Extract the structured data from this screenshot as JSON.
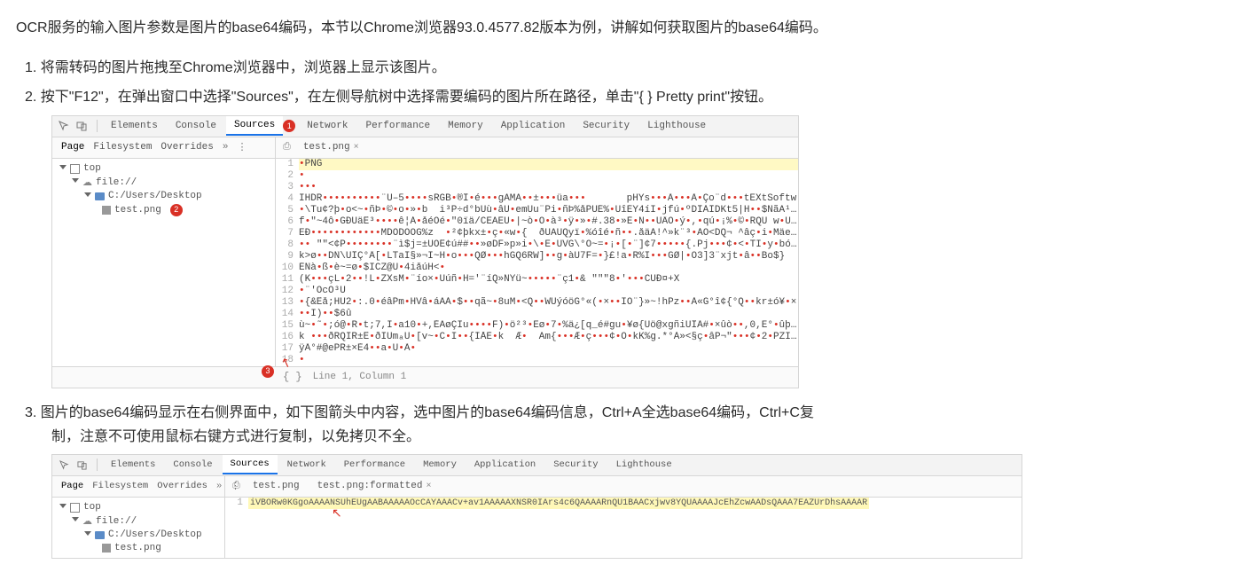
{
  "intro": "OCR服务的输入图片参数是图片的base64编码，本节以Chrome浏览器93.0.4577.82版本为例，讲解如何获取图片的base64编码。",
  "steps": {
    "s1": "1. 将需转码的图片拖拽至Chrome浏览器中，浏览器上显示该图片。",
    "s2": "2. 按下\"F12\"，在弹出窗口中选择\"Sources\"，在左侧导航树中选择需要编码的图片所在路径，单击\"{ } Pretty print\"按钮。",
    "s3a": "3. 图片的base64编码显示在右侧界面中，如下图箭头中内容，选中图片的base64编码信息，Ctrl+A全选base64编码，Ctrl+C复",
    "s3b": "制，注意不可使用鼠标右键方式进行复制，以免拷贝不全。"
  },
  "devtools_tabs": {
    "elements": "Elements",
    "console": "Console",
    "sources": "Sources",
    "network": "Network",
    "performance": "Performance",
    "memory": "Memory",
    "application": "Application",
    "security": "Security",
    "lighthouse": "Lighthouse"
  },
  "sub_tabs": {
    "page": "Page",
    "filesystem": "Filesystem",
    "overrides": "Overrides",
    "more": "»"
  },
  "file_tab": {
    "name": "test.png",
    "close": "×"
  },
  "file_tab2": {
    "name": "test.png:formatted",
    "close": "×"
  },
  "tree": {
    "top": "top",
    "scheme": "file://",
    "folder": "C:/Users/Desktop",
    "file": "test.png"
  },
  "markers": {
    "m1": "1",
    "m2": "2",
    "m3": "3"
  },
  "code1": {
    "lines": [
      {
        "n": "1",
        "hl": true,
        "t": "•PNG"
      },
      {
        "n": "2",
        "hl": false,
        "t": "•"
      },
      {
        "n": "3",
        "hl": false,
        "t": "•••"
      },
      {
        "n": "4",
        "hl": false,
        "t": "IHDR••••••••••¨Ù–5••••sRGB•®Î•é•••gAMA••±•••üa•••\tpHYs•••Ã•••Ã•Ço¨d•••tEXtSoftw"
      },
      {
        "n": "5",
        "hl": false,
        "t": "•\\Tu¢?þ•o<~•ñÞ•©•o•»•b  i³P÷d°bUù•âU•emUu¨Pi•ñÞ%åPÛÉ%•ÚîÉY4íÏ•jfú•ºDÎÀÎDKt5|H••$ÑãA¹×•a•ï"
      },
      {
        "n": "6",
        "hl": false,
        "t": "f•\"~4ô•GÐÙäÊ³••••ê¦Á•åéÔé•\"0ïä/CEAEU•|~ò•Ó•à³•ÿ•»•#.38•»É•N••UÂÒ•ý•,•qú•¡%•©•RQU¯w•Ü%•Tô3¢°g•×•C"
      },
      {
        "n": "7",
        "hl": false,
        "t": "EÐ••••••••••••MDÒDOÔG%z  •²¢þkx±•ç•«w•{  ðUÄÙQyï•%óîé•ñ••.åäÀ!^»k¨³•ÀO<DQ¬¯^âç•i•Mäeè³•g»•=•Ç(:>"
      },
      {
        "n": "8",
        "hl": false,
        "t": "••¯\"\"<¢P••••••••¨ì$j=±ÙÔÊ¢ú##••»øDF»p»i•\\•E•UVG\\°O~=•¡•[•¨]¢7•••••{.Pj•••¢•<•TI•y•bó1QP••"
      },
      {
        "n": "9",
        "hl": false,
        "t": "k>ø••DÑ\\ÙÎÇ°Â[•LTaI§»¬Ï~H•o•••QØ•••hGQ6RW]••g•àU7F=•}£!a•R%Ï•••GØ|•Ô3]3¨xjt•â••Bo$}"
      },
      {
        "n": "10",
        "hl": false,
        "t": "ÈÑà•ß•è~=ø•$ÏCZ@Û•4iåúH<•"
      },
      {
        "n": "11",
        "hl": false,
        "t": "(K•••çL•2••!L•ZXsM•¨ío×•Ûúñ•H='¨íQ»NYü~•••••¨ç1•&¯\"\"\"8•'•••CÚÐ¤+X"
      },
      {
        "n": "12",
        "hl": false,
        "t": "•¨'ÔcÔ³Û"
      },
      {
        "n": "13",
        "hl": false,
        "t": "•{&Êå;HÛ2•:.0•éâPm•HVâ•áÄÀ•$••qã~•8uM•<Q••WÛýóöG°«(•×••ÏÔ¨}»~!hPz••À«G°î¢{°Q••kr±ó¥•×"
      },
      {
        "n": "14",
        "hl": false,
        "t": "••Ï)••$6û"
      },
      {
        "n": "15",
        "hl": false,
        "t": "ù~•˜•;ó@•R•t;7,Ï•a10•+,ÈAøÇÏu••••F)•ö²³•Eø•7•%ä¿[q_é#gu•¥ø{Ûö@xgñiUÎÃ#•×ûò••,0,E°•ûþUU¡¦¨~:ú"
      },
      {
        "n": "16",
        "hl": false,
        "t": "k¯•••ðRQÏR±Ê•ðÏÙmₐÚ•[v~•C•Ï••{ÍÅÈ•k  Æ•  Äm{•••Æ•ç•••¢•Ô•kK%g.*°À»<§ç•âP¬\"•••¢•2•PZÏ\\§<"
      },
      {
        "n": "17",
        "hl": false,
        "t": "ÿÃ°#@ePR±×È4••a•Ü•Ã•"
      },
      {
        "n": "18",
        "hl": false,
        "t": "•"
      }
    ]
  },
  "footer1": {
    "pretty": "{ }",
    "loc": "Line 1, Column 1"
  },
  "code2": {
    "line_num": "1",
    "base64": "iVBORw0KGgoAAAANSUhEUgAABAAAAAOcCAYAAACv+av1AAAAAXNSR0IArs4c6QAAAARnQU1BAACxjwv8YQUAAAAJcEhZcwAADsQAAA7EAZUrDhsAAAAR"
  }
}
